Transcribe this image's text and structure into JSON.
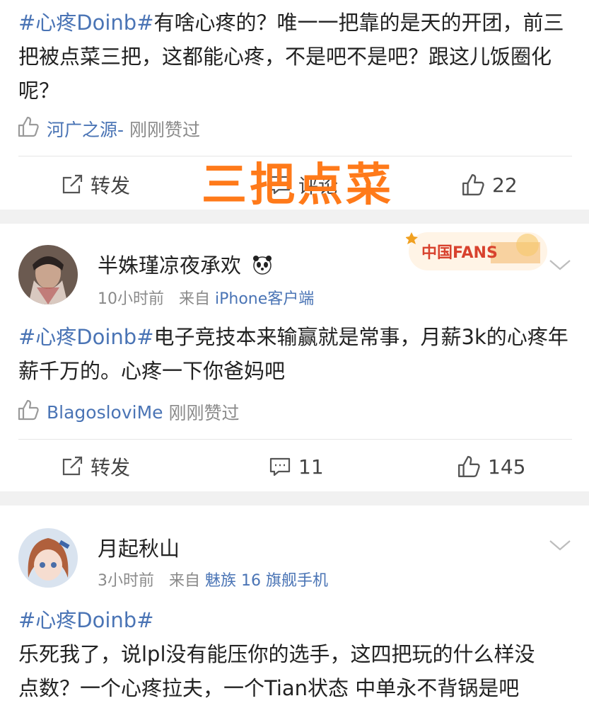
{
  "post1": {
    "text_tag": "#心疼Doinb#",
    "text_body": "有啥心疼的？唯一一把靠的是天的开团，前三把被点菜三把，这都能心疼，不是吧不是吧？跟这儿饭圈化呢？",
    "liked_by": "河广之源-",
    "liked_label": "刚刚赞过",
    "repost_label": "转发",
    "comment_label": "评论",
    "like_count": "22"
  },
  "overlay_caption": "三把点菜",
  "post2": {
    "username": "半姝瑾凉夜承欢",
    "time": "10小时前",
    "from_label": "来自",
    "source": "iPhone客户端",
    "badge_text": "中国FANS",
    "text_tag": "#心疼Doinb#",
    "text_body": "电子竞技本来输赢就是常事，月薪3k的心疼年薪千万的。心疼一下你爸妈吧",
    "liked_by": "BlagosloviMe",
    "liked_label": "刚刚赞过",
    "repost_label": "转发",
    "comment_count": "11",
    "like_count": "145"
  },
  "post3": {
    "username": "月起秋山",
    "time": "3小时前",
    "from_label": "来自",
    "source": "魅族 16 旗舰手机",
    "text_tag": "#心疼Doinb#",
    "text_line1": "乐死我了，说lpl没有能压你的选手，这四把玩的什么样没",
    "text_line2": "点数？一个心疼拉夫，一个Tian状态 中单永不背锅是吧"
  },
  "colors": {
    "link_blue": "#4a74b5",
    "overlay_orange": "#ff7a1a",
    "separator_gray": "#f1f1f1"
  },
  "icons": [
    "like-icon",
    "repost-icon",
    "comment-icon",
    "chevron-down-icon",
    "panda-emoji-icon"
  ]
}
